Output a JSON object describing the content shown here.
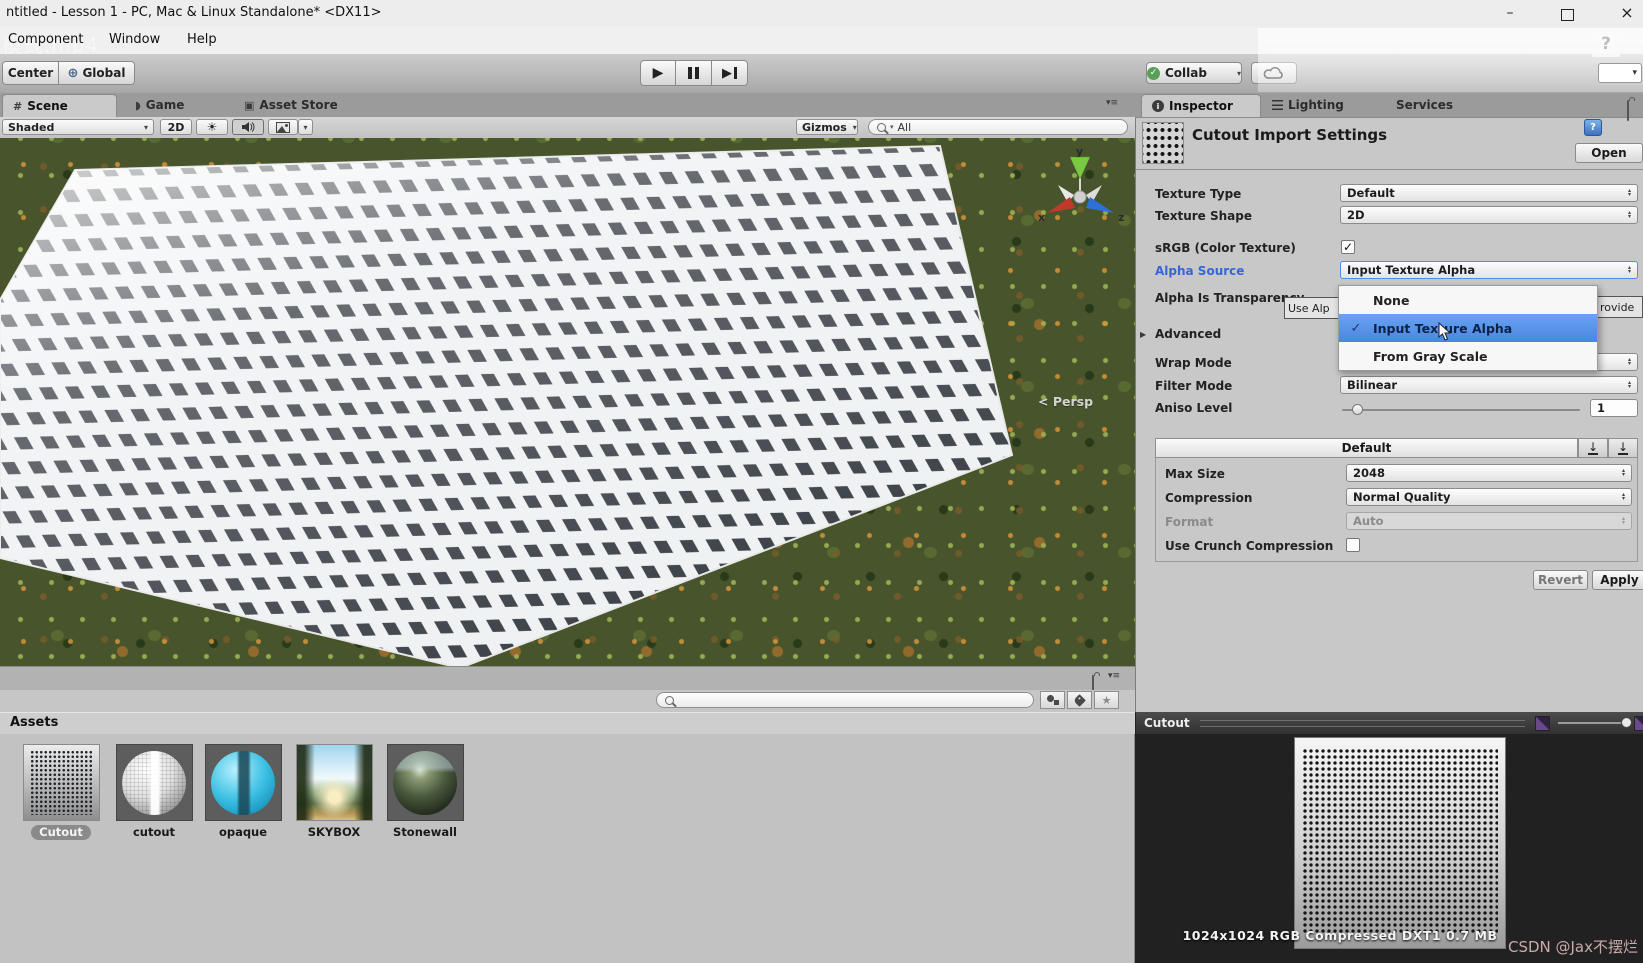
{
  "window": {
    "title": "ntitled - Lesson 1 - PC, Mac & Linux Standalone* <DX11>",
    "minimize": "–",
    "close": "×"
  },
  "menu_bar": {
    "items": [
      "Component",
      "Window",
      "Help"
    ],
    "watermark": "模式.mp4",
    "ghost_help": "?"
  },
  "toolbar": {
    "center_label": "Center",
    "global_label": "Global",
    "collab_label": "Collab"
  },
  "left_tabs": {
    "scene": "Scene",
    "game": "Game",
    "asset_store": "Asset Store"
  },
  "scene_toolbar": {
    "shading_mode": "Shaded",
    "mode_2d": "2D",
    "gizmos": "Gizmos",
    "search_value": "All"
  },
  "scene_view": {
    "persp_label": "< Persp",
    "axis": {
      "x": "x",
      "y": "y",
      "z": "z"
    }
  },
  "project": {
    "header": "Assets",
    "assets": [
      {
        "name": "Cutout",
        "selected": true
      },
      {
        "name": "cutout",
        "selected": false
      },
      {
        "name": "opaque",
        "selected": false
      },
      {
        "name": "SKYBOX",
        "selected": false
      },
      {
        "name": "Stonewall",
        "selected": false
      }
    ]
  },
  "inspector": {
    "tabs": {
      "inspector": "Inspector",
      "lighting": "Lighting",
      "services": "Services"
    },
    "title": "Cutout Import Settings",
    "open_button": "Open",
    "fields": {
      "texture_type": {
        "label": "Texture Type",
        "value": "Default"
      },
      "texture_shape": {
        "label": "Texture Shape",
        "value": "2D"
      },
      "srgb": {
        "label": "sRGB (Color Texture)",
        "checked": true
      },
      "alpha_source": {
        "label": "Alpha Source",
        "value": "Input Texture Alpha"
      },
      "alpha_is_transparency": {
        "label": "Alpha Is Transparency"
      },
      "advanced": {
        "label": "Advanced"
      },
      "wrap_mode": {
        "label": "Wrap Mode"
      },
      "filter_mode": {
        "label": "Filter Mode",
        "value": "Bilinear"
      },
      "aniso_level": {
        "label": "Aniso Level",
        "value": "1"
      }
    },
    "tooltip": {
      "left_fragment": "Use Alp",
      "right_fragment": "rovide"
    },
    "alpha_source_dropdown": {
      "options": [
        {
          "label": "None",
          "checked": false
        },
        {
          "label": "Input Texture Alpha",
          "checked": true
        },
        {
          "label": "From Gray Scale",
          "checked": false
        }
      ]
    },
    "platform": {
      "tab": "Default",
      "max_size": {
        "label": "Max Size",
        "value": "2048"
      },
      "compression": {
        "label": "Compression",
        "value": "Normal Quality"
      },
      "format": {
        "label": "Format",
        "value": "Auto"
      },
      "crunch": {
        "label": "Use Crunch Compression",
        "checked": false
      }
    },
    "buttons": {
      "revert": "Revert",
      "apply": "Apply"
    }
  },
  "preview": {
    "title": "Cutout",
    "info": "1024x1024  RGB Compressed DXT1  0.7 MB"
  },
  "site_watermark": "CSDN @Jax不摆烂",
  "icons": {
    "dropdown_arrow": "▾",
    "spin_up": "▴",
    "spin_down": "▾",
    "check": "✓",
    "star": "★",
    "globe": "⊕",
    "sun": "☀",
    "scene_hash": "#",
    "game": "◗",
    "asset_store": "▣",
    "menu_lines": "≡",
    "inspector_i": "i",
    "play": "▶",
    "advanced_arrow": "▶",
    "platform_download": "↓",
    "lock_arrow": "▾"
  },
  "colors": {
    "highlight_blue": "#4f8ee8",
    "alpha_label_blue": "#3565d6",
    "panel_gray": "#c2c2c2",
    "preview_bg": "#212121"
  }
}
